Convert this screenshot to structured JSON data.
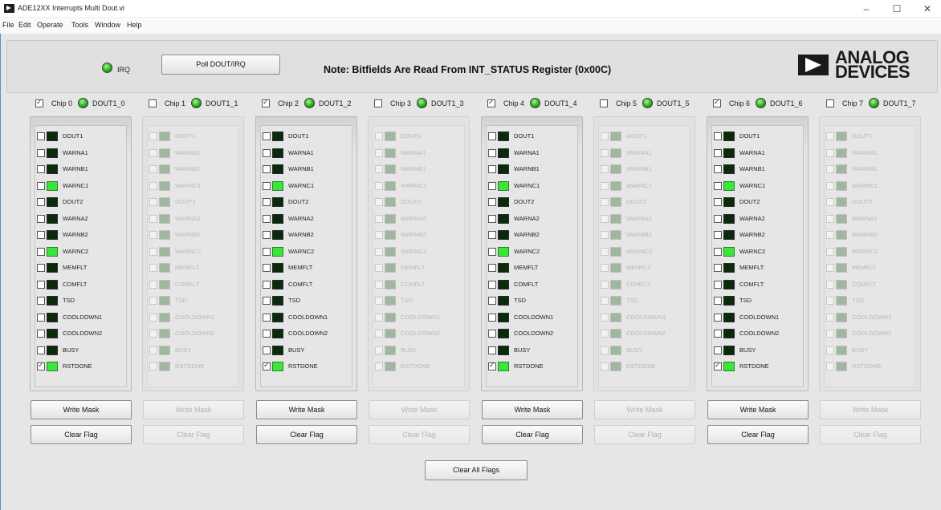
{
  "window": {
    "title": "ADE12XX Interrupts Multi Dout.vi"
  },
  "menu": [
    "File",
    "Edit",
    "Operate",
    "Tools",
    "Window",
    "Help"
  ],
  "header": {
    "irq_label": "IRQ",
    "poll_button": "Poll DOUT/IRQ",
    "note": "Note: Bitfields Are Read From INT_STATUS Register (0x00C)",
    "logo_line1": "ANALOG",
    "logo_line2": "DEVICES"
  },
  "flag_names": [
    "DOUT1",
    "WARNA1",
    "WARNB1",
    "WARNC1",
    "DOUT2",
    "WARNA2",
    "WARNB2",
    "WARNC2",
    "MEMFLT",
    "COMFLT",
    "TSD",
    "COOLDOWN1",
    "COOLDOWN2",
    "BUSY",
    "RSTDONE"
  ],
  "chips": [
    {
      "label": "Chip 0",
      "dout_label": "DOUT1_0",
      "checked": true,
      "enabled": true,
      "led_on": [
        false,
        false,
        false,
        true,
        false,
        false,
        false,
        true,
        false,
        false,
        false,
        false,
        false,
        false,
        true
      ],
      "mask_checked": [
        false,
        false,
        false,
        false,
        false,
        false,
        false,
        false,
        false,
        false,
        false,
        false,
        false,
        false,
        true
      ]
    },
    {
      "label": "Chip 1",
      "dout_label": "DOUT1_1",
      "checked": false,
      "enabled": false,
      "led_on": [
        false,
        false,
        false,
        false,
        false,
        false,
        false,
        false,
        false,
        false,
        false,
        false,
        false,
        false,
        false
      ],
      "mask_checked": [
        false,
        false,
        false,
        false,
        false,
        false,
        false,
        false,
        false,
        false,
        false,
        false,
        false,
        false,
        false
      ]
    },
    {
      "label": "Chip 2",
      "dout_label": "DOUT1_2",
      "checked": true,
      "enabled": true,
      "led_on": [
        false,
        false,
        false,
        true,
        false,
        false,
        false,
        true,
        false,
        false,
        false,
        false,
        false,
        false,
        true
      ],
      "mask_checked": [
        false,
        false,
        false,
        false,
        false,
        false,
        false,
        false,
        false,
        false,
        false,
        false,
        false,
        false,
        true
      ]
    },
    {
      "label": "Chip 3",
      "dout_label": "DOUT1_3",
      "checked": false,
      "enabled": false,
      "led_on": [
        false,
        false,
        false,
        false,
        false,
        false,
        false,
        false,
        false,
        false,
        false,
        false,
        false,
        false,
        false
      ],
      "mask_checked": [
        false,
        false,
        false,
        false,
        false,
        false,
        false,
        false,
        false,
        false,
        false,
        false,
        false,
        false,
        false
      ]
    },
    {
      "label": "Chip 4",
      "dout_label": "DOUT1_4",
      "checked": true,
      "enabled": true,
      "led_on": [
        false,
        false,
        false,
        true,
        false,
        false,
        false,
        true,
        false,
        false,
        false,
        false,
        false,
        false,
        true
      ],
      "mask_checked": [
        false,
        false,
        false,
        false,
        false,
        false,
        false,
        false,
        false,
        false,
        false,
        false,
        false,
        false,
        true
      ]
    },
    {
      "label": "Chip 5",
      "dout_label": "DOUT1_5",
      "checked": false,
      "enabled": false,
      "led_on": [
        false,
        false,
        false,
        false,
        false,
        false,
        false,
        false,
        false,
        false,
        false,
        false,
        false,
        false,
        false
      ],
      "mask_checked": [
        false,
        false,
        false,
        false,
        false,
        false,
        false,
        false,
        false,
        false,
        false,
        false,
        false,
        false,
        false
      ]
    },
    {
      "label": "Chip 6",
      "dout_label": "DOUT1_6",
      "checked": true,
      "enabled": true,
      "led_on": [
        false,
        false,
        false,
        true,
        false,
        false,
        false,
        true,
        false,
        false,
        false,
        false,
        false,
        false,
        true
      ],
      "mask_checked": [
        false,
        false,
        false,
        false,
        false,
        false,
        false,
        false,
        false,
        false,
        false,
        false,
        false,
        false,
        true
      ]
    },
    {
      "label": "Chip 7",
      "dout_label": "DOUT1_7",
      "checked": false,
      "enabled": false,
      "led_on": [
        false,
        false,
        false,
        false,
        false,
        false,
        false,
        false,
        false,
        false,
        false,
        false,
        false,
        false,
        false
      ],
      "mask_checked": [
        false,
        false,
        false,
        false,
        false,
        false,
        false,
        false,
        false,
        false,
        false,
        false,
        false,
        false,
        false
      ]
    }
  ],
  "buttons": {
    "write_mask": "Write Mask",
    "clear_flag": "Clear Flag",
    "clear_all": "Clear All Flags"
  },
  "icons": {
    "app": "labview-vi-icon",
    "minimize": "minimize-icon",
    "maximize": "maximize-icon",
    "close": "close-icon",
    "led": "green-led-icon"
  },
  "colors": {
    "led_on": "#3ae63a",
    "led_off": "#0a2a0a",
    "window_bg": "#e6e6e6"
  }
}
